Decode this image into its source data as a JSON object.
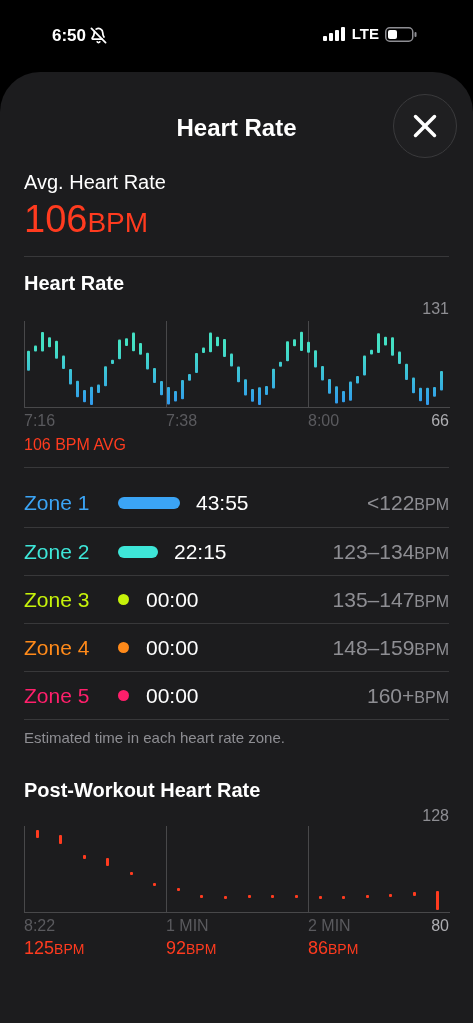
{
  "status_bar": {
    "time": "6:50",
    "network": "LTE"
  },
  "sheet": {
    "title": "Heart Rate"
  },
  "average": {
    "label": "Avg. Heart Rate",
    "value": "106",
    "unit": "BPM"
  },
  "heart_rate": {
    "title": "Heart Rate",
    "y_max": "131",
    "y_min": "66",
    "x_labels": [
      "7:16",
      "7:38",
      "8:00"
    ],
    "average_label": "106 BPM AVG"
  },
  "zones": [
    {
      "name": "Zone 1",
      "color": "#3ba4f5",
      "kind": "long",
      "time": "43:55",
      "range": "<122",
      "unit": "BPM"
    },
    {
      "name": "Zone 2",
      "color": "#3ee6d8",
      "kind": "short",
      "time": "22:15",
      "range": "123–134",
      "unit": "BPM"
    },
    {
      "name": "Zone 3",
      "color": "#c6f20a",
      "kind": "dot",
      "time": "00:00",
      "range": "135–147",
      "unit": "BPM"
    },
    {
      "name": "Zone 4",
      "color": "#ff8a1a",
      "kind": "dot",
      "time": "00:00",
      "range": "148–159",
      "unit": "BPM"
    },
    {
      "name": "Zone 5",
      "color": "#ff1f6b",
      "kind": "dot",
      "time": "00:00",
      "range": "160+",
      "unit": "BPM"
    }
  ],
  "zones_note": "Estimated time in each heart rate zone.",
  "post_workout": {
    "title": "Post-Workout Heart Rate",
    "y_max": "128",
    "y_min": "80",
    "points": [
      {
        "label": "8:22",
        "value": "125",
        "unit": "BPM"
      },
      {
        "label": "1 MIN",
        "value": "92",
        "unit": "BPM"
      },
      {
        "label": "2 MIN",
        "value": "86",
        "unit": "BPM"
      }
    ]
  }
}
